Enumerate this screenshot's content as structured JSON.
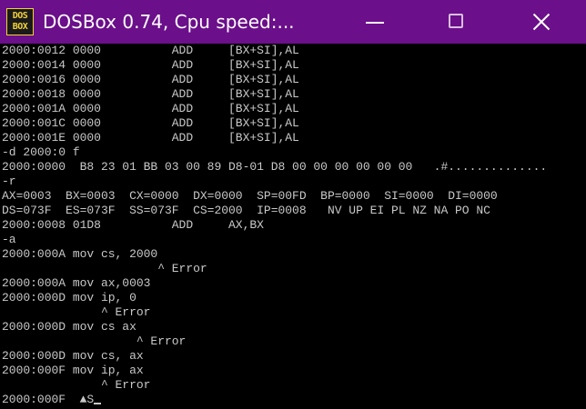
{
  "window": {
    "title": "DOSBox 0.74, Cpu speed:...",
    "icon": {
      "name": "dosbox-icon",
      "line1": "DOS",
      "line2": "BOX"
    },
    "colors": {
      "titlebar": "#6b0f8a",
      "console_bg": "#000000",
      "console_text": "#c8c8c8"
    }
  },
  "controls": {
    "minimize": "minimize-icon",
    "maximize": "maximize-icon",
    "close": "close-icon"
  },
  "console": {
    "lines": [
      "2000:0012 0000          ADD     [BX+SI],AL",
      "2000:0014 0000          ADD     [BX+SI],AL",
      "2000:0016 0000          ADD     [BX+SI],AL",
      "2000:0018 0000          ADD     [BX+SI],AL",
      "2000:001A 0000          ADD     [BX+SI],AL",
      "2000:001C 0000          ADD     [BX+SI],AL",
      "2000:001E 0000          ADD     [BX+SI],AL",
      "-d 2000:0 f",
      "2000:0000  B8 23 01 BB 03 00 89 D8-01 D8 00 00 00 00 00 00   .#..............",
      "-r",
      "AX=0003  BX=0003  CX=0000  DX=0000  SP=00FD  BP=0000  SI=0000  DI=0000",
      "DS=073F  ES=073F  SS=073F  CS=2000  IP=0008   NV UP EI PL NZ NA PO NC",
      "2000:0008 01D8          ADD     AX,BX",
      "-a",
      "2000:000A mov cs, 2000",
      "                      ^ Error",
      "2000:000A mov ax,0003",
      "2000:000D mov ip, 0",
      "              ^ Error",
      "2000:000D mov cs ax",
      "                   ^ Error",
      "2000:000D mov cs, ax",
      "2000:000F mov ip, ax",
      "              ^ Error"
    ],
    "prompt_line": "2000:000F  ▲S"
  }
}
